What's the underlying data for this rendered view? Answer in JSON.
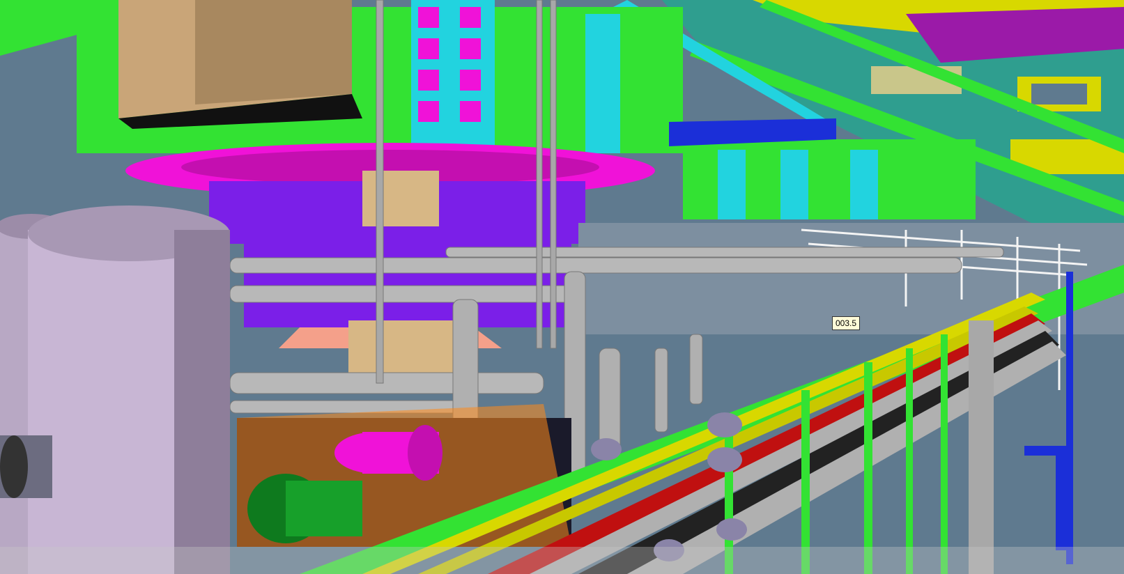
{
  "viewport": {
    "tag_label": "003.5"
  },
  "colors": {
    "background": "#5f7a8f",
    "steel_green": "#33e233",
    "steel_cyan": "#22d3df",
    "magenta": "#f012d8",
    "violet": "#7b1fe8",
    "tan": "#c9a578",
    "vessel": "#c8b6d4",
    "pipe_gray": "#b8b8b8",
    "yellow": "#d8d800",
    "red": "#c01010",
    "tag_bg": "#fffbd8"
  },
  "icons": {
    "tag": "label-tag-icon"
  }
}
